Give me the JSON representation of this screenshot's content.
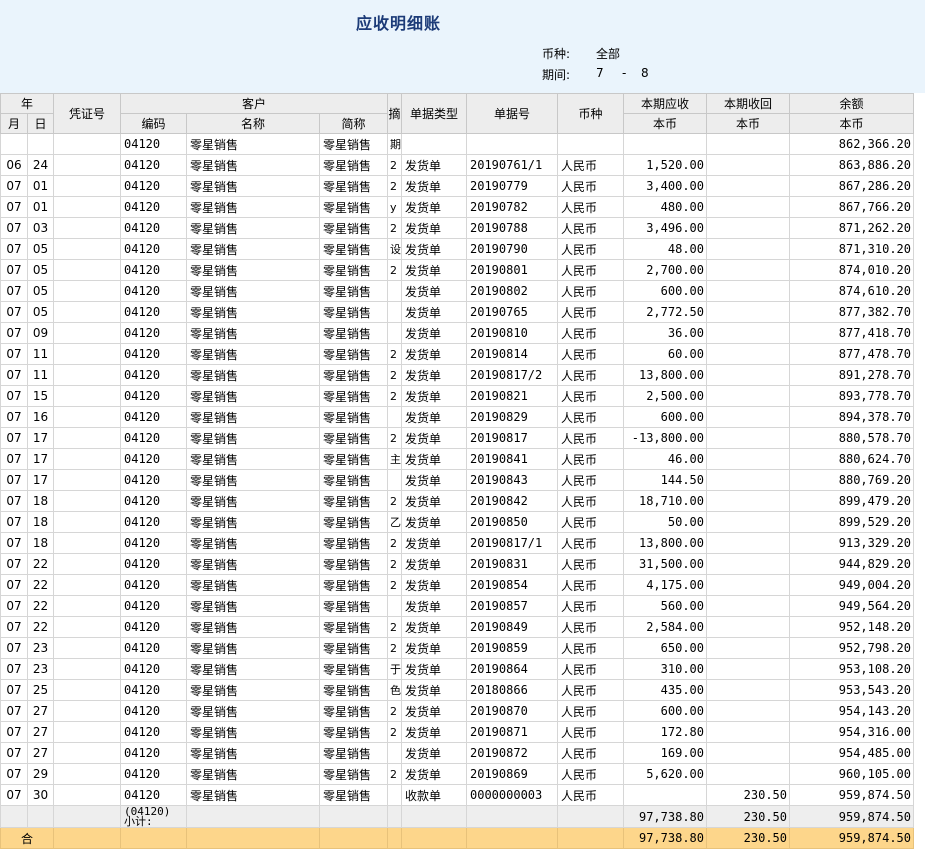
{
  "report": {
    "title": "应收明细账",
    "currency_label": "币种:",
    "currency_value": "全部",
    "period_label": "期间:",
    "period_from": "7",
    "period_sep": "-",
    "period_to": "8"
  },
  "columns": {
    "year": "年",
    "month": "月",
    "day": "日",
    "voucher": "凭证号",
    "customer": "客户",
    "code": "编码",
    "name": "名称",
    "short": "简称",
    "summary": "摘",
    "doc_type": "单据类型",
    "doc_no": "单据号",
    "currency": "币种",
    "debit": "本期应收",
    "credit": "本期收回",
    "balance": "余额",
    "local": "本币"
  },
  "opening": {
    "code": "04120",
    "name": "零星销售",
    "short": "零星销售",
    "summary": "期",
    "balance": "862,366.20"
  },
  "rows": [
    {
      "m": "06",
      "d": "24",
      "code": "04120",
      "name": "零星销售",
      "short": "零星销售",
      "s": "2",
      "type": "发货单",
      "no": "20190761/1",
      "cur": "人民币",
      "debit": "1,520.00",
      "credit": "",
      "bal": "863,886.20"
    },
    {
      "m": "07",
      "d": "01",
      "code": "04120",
      "name": "零星销售",
      "short": "零星销售",
      "s": "2",
      "type": "发货单",
      "no": "20190779",
      "cur": "人民币",
      "debit": "3,400.00",
      "credit": "",
      "bal": "867,286.20"
    },
    {
      "m": "07",
      "d": "01",
      "code": "04120",
      "name": "零星销售",
      "short": "零星销售",
      "s": "y",
      "type": "发货单",
      "no": "20190782",
      "cur": "人民币",
      "debit": "480.00",
      "credit": "",
      "bal": "867,766.20"
    },
    {
      "m": "07",
      "d": "03",
      "code": "04120",
      "name": "零星销售",
      "short": "零星销售",
      "s": "2",
      "type": "发货单",
      "no": "20190788",
      "cur": "人民币",
      "debit": "3,496.00",
      "credit": "",
      "bal": "871,262.20"
    },
    {
      "m": "07",
      "d": "05",
      "code": "04120",
      "name": "零星销售",
      "short": "零星销售",
      "s": "设",
      "type": "发货单",
      "no": "20190790",
      "cur": "人民币",
      "debit": "48.00",
      "credit": "",
      "bal": "871,310.20"
    },
    {
      "m": "07",
      "d": "05",
      "code": "04120",
      "name": "零星销售",
      "short": "零星销售",
      "s": "2",
      "type": "发货单",
      "no": "20190801",
      "cur": "人民币",
      "debit": "2,700.00",
      "credit": "",
      "bal": "874,010.20"
    },
    {
      "m": "07",
      "d": "05",
      "code": "04120",
      "name": "零星销售",
      "short": "零星销售",
      "s": "",
      "type": "发货单",
      "no": "20190802",
      "cur": "人民币",
      "debit": "600.00",
      "credit": "",
      "bal": "874,610.20"
    },
    {
      "m": "07",
      "d": "05",
      "code": "04120",
      "name": "零星销售",
      "short": "零星销售",
      "s": "",
      "type": "发货单",
      "no": "20190765",
      "cur": "人民币",
      "debit": "2,772.50",
      "credit": "",
      "bal": "877,382.70"
    },
    {
      "m": "07",
      "d": "09",
      "code": "04120",
      "name": "零星销售",
      "short": "零星销售",
      "s": "",
      "type": "发货单",
      "no": "20190810",
      "cur": "人民币",
      "debit": "36.00",
      "credit": "",
      "bal": "877,418.70"
    },
    {
      "m": "07",
      "d": "11",
      "code": "04120",
      "name": "零星销售",
      "short": "零星销售",
      "s": "2",
      "type": "发货单",
      "no": "20190814",
      "cur": "人民币",
      "debit": "60.00",
      "credit": "",
      "bal": "877,478.70"
    },
    {
      "m": "07",
      "d": "11",
      "code": "04120",
      "name": "零星销售",
      "short": "零星销售",
      "s": "2",
      "type": "发货单",
      "no": "20190817/2",
      "cur": "人民币",
      "debit": "13,800.00",
      "credit": "",
      "bal": "891,278.70"
    },
    {
      "m": "07",
      "d": "15",
      "code": "04120",
      "name": "零星销售",
      "short": "零星销售",
      "s": "2",
      "type": "发货单",
      "no": "20190821",
      "cur": "人民币",
      "debit": "2,500.00",
      "credit": "",
      "bal": "893,778.70"
    },
    {
      "m": "07",
      "d": "16",
      "code": "04120",
      "name": "零星销售",
      "short": "零星销售",
      "s": "",
      "type": "发货单",
      "no": "20190829",
      "cur": "人民币",
      "debit": "600.00",
      "credit": "",
      "bal": "894,378.70"
    },
    {
      "m": "07",
      "d": "17",
      "code": "04120",
      "name": "零星销售",
      "short": "零星销售",
      "s": "2",
      "type": "发货单",
      "no": "20190817",
      "cur": "人民币",
      "debit": "-13,800.00",
      "credit": "",
      "bal": "880,578.70"
    },
    {
      "m": "07",
      "d": "17",
      "code": "04120",
      "name": "零星销售",
      "short": "零星销售",
      "s": "主",
      "type": "发货单",
      "no": "20190841",
      "cur": "人民币",
      "debit": "46.00",
      "credit": "",
      "bal": "880,624.70"
    },
    {
      "m": "07",
      "d": "17",
      "code": "04120",
      "name": "零星销售",
      "short": "零星销售",
      "s": "",
      "type": "发货单",
      "no": "20190843",
      "cur": "人民币",
      "debit": "144.50",
      "credit": "",
      "bal": "880,769.20"
    },
    {
      "m": "07",
      "d": "18",
      "code": "04120",
      "name": "零星销售",
      "short": "零星销售",
      "s": "2",
      "type": "发货单",
      "no": "20190842",
      "cur": "人民币",
      "debit": "18,710.00",
      "credit": "",
      "bal": "899,479.20"
    },
    {
      "m": "07",
      "d": "18",
      "code": "04120",
      "name": "零星销售",
      "short": "零星销售",
      "s": "乙",
      "type": "发货单",
      "no": "20190850",
      "cur": "人民币",
      "debit": "50.00",
      "credit": "",
      "bal": "899,529.20"
    },
    {
      "m": "07",
      "d": "18",
      "code": "04120",
      "name": "零星销售",
      "short": "零星销售",
      "s": "2",
      "type": "发货单",
      "no": "20190817/1",
      "cur": "人民币",
      "debit": "13,800.00",
      "credit": "",
      "bal": "913,329.20"
    },
    {
      "m": "07",
      "d": "22",
      "code": "04120",
      "name": "零星销售",
      "short": "零星销售",
      "s": "2",
      "type": "发货单",
      "no": "20190831",
      "cur": "人民币",
      "debit": "31,500.00",
      "credit": "",
      "bal": "944,829.20"
    },
    {
      "m": "07",
      "d": "22",
      "code": "04120",
      "name": "零星销售",
      "short": "零星销售",
      "s": "2",
      "type": "发货单",
      "no": "20190854",
      "cur": "人民币",
      "debit": "4,175.00",
      "credit": "",
      "bal": "949,004.20"
    },
    {
      "m": "07",
      "d": "22",
      "code": "04120",
      "name": "零星销售",
      "short": "零星销售",
      "s": "",
      "type": "发货单",
      "no": "20190857",
      "cur": "人民币",
      "debit": "560.00",
      "credit": "",
      "bal": "949,564.20"
    },
    {
      "m": "07",
      "d": "22",
      "code": "04120",
      "name": "零星销售",
      "short": "零星销售",
      "s": "2",
      "type": "发货单",
      "no": "20190849",
      "cur": "人民币",
      "debit": "2,584.00",
      "credit": "",
      "bal": "952,148.20"
    },
    {
      "m": "07",
      "d": "23",
      "code": "04120",
      "name": "零星销售",
      "short": "零星销售",
      "s": "2",
      "type": "发货单",
      "no": "20190859",
      "cur": "人民币",
      "debit": "650.00",
      "credit": "",
      "bal": "952,798.20"
    },
    {
      "m": "07",
      "d": "23",
      "code": "04120",
      "name": "零星销售",
      "short": "零星销售",
      "s": "于",
      "type": "发货单",
      "no": "20190864",
      "cur": "人民币",
      "debit": "310.00",
      "credit": "",
      "bal": "953,108.20"
    },
    {
      "m": "07",
      "d": "25",
      "code": "04120",
      "name": "零星销售",
      "short": "零星销售",
      "s": "色",
      "type": "发货单",
      "no": "20180866",
      "cur": "人民币",
      "debit": "435.00",
      "credit": "",
      "bal": "953,543.20"
    },
    {
      "m": "07",
      "d": "27",
      "code": "04120",
      "name": "零星销售",
      "short": "零星销售",
      "s": "2",
      "type": "发货单",
      "no": "20190870",
      "cur": "人民币",
      "debit": "600.00",
      "credit": "",
      "bal": "954,143.20"
    },
    {
      "m": "07",
      "d": "27",
      "code": "04120",
      "name": "零星销售",
      "short": "零星销售",
      "s": "2",
      "type": "发货单",
      "no": "20190871",
      "cur": "人民币",
      "debit": "172.80",
      "credit": "",
      "bal": "954,316.00"
    },
    {
      "m": "07",
      "d": "27",
      "code": "04120",
      "name": "零星销售",
      "short": "零星销售",
      "s": "",
      "type": "发货单",
      "no": "20190872",
      "cur": "人民币",
      "debit": "169.00",
      "credit": "",
      "bal": "954,485.00"
    },
    {
      "m": "07",
      "d": "29",
      "code": "04120",
      "name": "零星销售",
      "short": "零星销售",
      "s": "2",
      "type": "发货单",
      "no": "20190869",
      "cur": "人民币",
      "debit": "5,620.00",
      "credit": "",
      "bal": "960,105.00"
    },
    {
      "m": "07",
      "d": "30",
      "code": "04120",
      "name": "零星销售",
      "short": "零星销售",
      "s": "",
      "type": "收款单",
      "no": "0000000003",
      "cur": "人民币",
      "debit": "",
      "credit": "230.50",
      "bal": "959,874.50"
    }
  ],
  "subtotal": {
    "label1": "(04120)",
    "label2": "小计:",
    "debit": "97,738.80",
    "credit": "230.50",
    "balance": "959,874.50"
  },
  "total": {
    "label": "合",
    "debit": "97,738.80",
    "credit": "230.50",
    "balance": "959,874.50"
  }
}
